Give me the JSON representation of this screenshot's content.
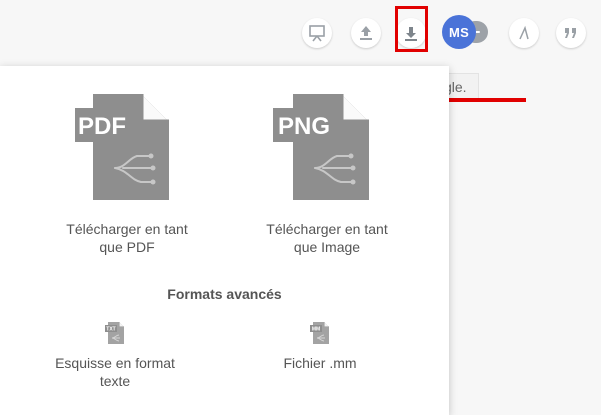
{
  "toolbar": {
    "icons": [
      "presentation-icon",
      "upload-icon",
      "download-icon",
      "text-style-icon",
      "quote-icon"
    ],
    "avatar_initials": "MS",
    "tooltip": "Télécharger ce Coggle."
  },
  "colors": {
    "highlight": "#e10000",
    "avatar": "#4a73d8",
    "file_icon": "#8e8e8e",
    "tooltip_bg": "#f2f2f2"
  },
  "export_panel": {
    "pdf": {
      "badge": "PDF",
      "label_line1": "Télécharger en tant",
      "label_line2": "que PDF"
    },
    "png": {
      "badge": "PNG",
      "label_line1": "Télécharger en tant",
      "label_line2": "que Image"
    },
    "advanced_title": "Formats avancés",
    "sketch": {
      "badge": "TXT",
      "label_line1": "Esquisse en format",
      "label_line2": "texte"
    },
    "mm": {
      "badge": "MM",
      "label": "Fichier .mm"
    }
  }
}
